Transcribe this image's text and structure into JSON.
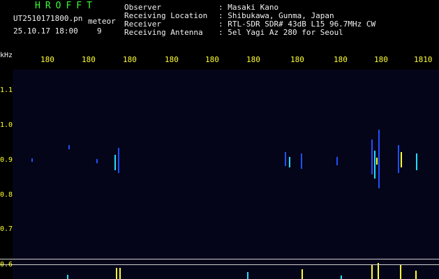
{
  "header": {
    "app_title": "HROFFT",
    "filename": "UT2510171800.pn",
    "meteor_label": "meteor",
    "datetime": "25.10.17 18:00",
    "count": "9"
  },
  "meta": [
    {
      "label": "Observer",
      "value": ": Masaki Kano"
    },
    {
      "label": "Receiving Location",
      "value": ": Shibukawa, Gunma, Japan"
    },
    {
      "label": "Receiver",
      "value": ": RTL-SDR SDR# 43dB L15 96.7MHz CW"
    },
    {
      "label": "Receiving Antenna",
      "value": ": 5el Yagi Az 280 for Seoul"
    }
  ],
  "axis": {
    "unit": "kHz",
    "y_ticks": [
      "1.1",
      "1.0",
      "0.9",
      "0.8",
      "0.7",
      "0.6"
    ],
    "x_ticks": [
      "180",
      "180",
      "180",
      "180",
      "180",
      "180",
      "180",
      "180",
      "180",
      "1810"
    ]
  },
  "colors": {
    "background": "#000000",
    "header_green": "#39ff39",
    "tick_yellow": "#ffff33",
    "signal_blue": "#1e50ff",
    "signal_cyan": "#22ddff",
    "signal_yellow": "#ffff33"
  }
}
